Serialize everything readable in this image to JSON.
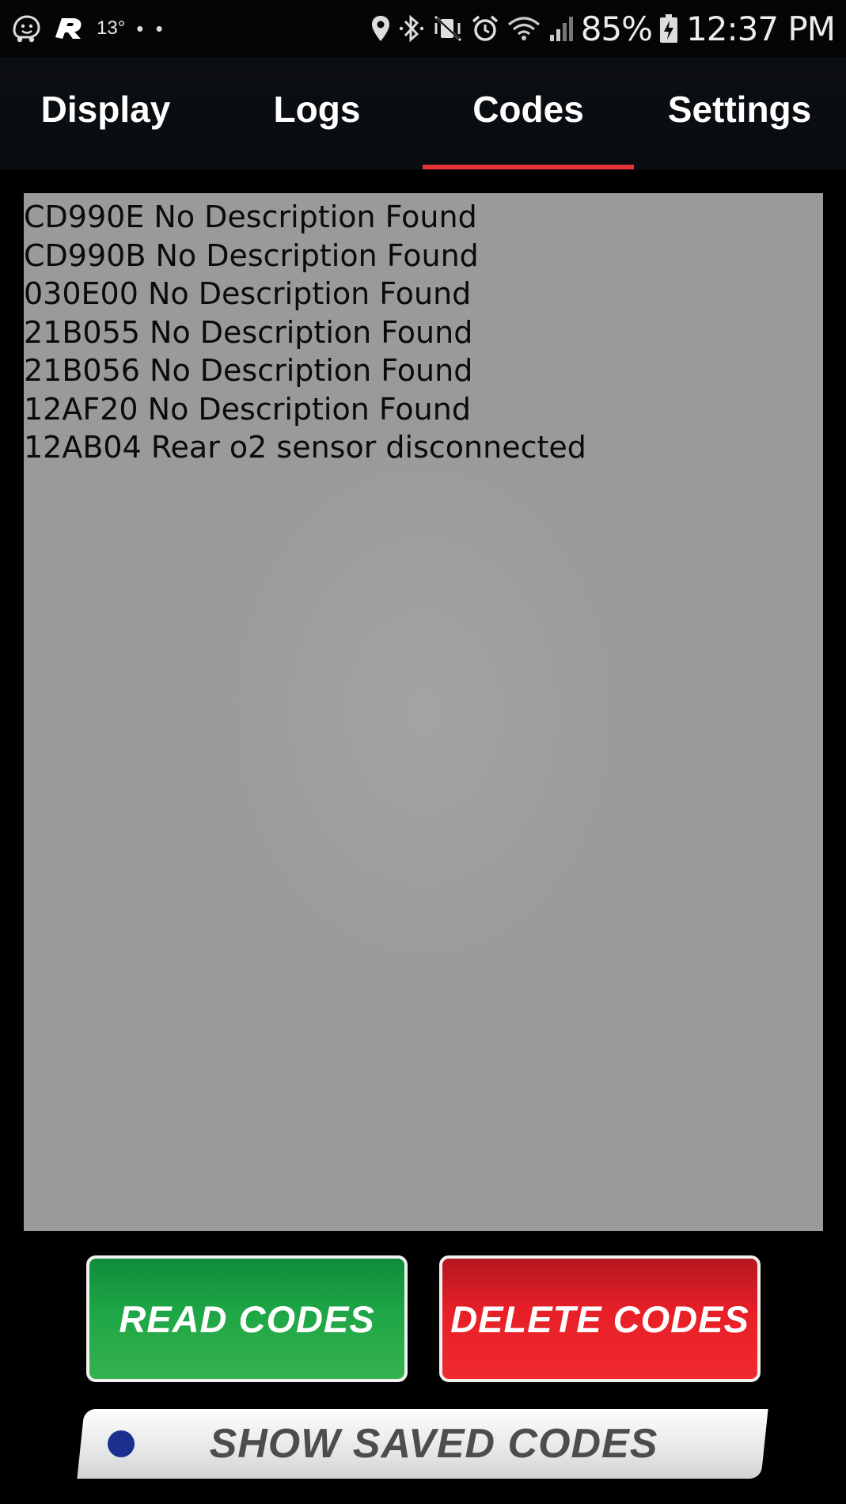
{
  "status_bar": {
    "temperature": "13°",
    "overflow": "• •",
    "battery_percent": "85%",
    "time": "12:37 PM",
    "icons": [
      "waze-icon",
      "app-r-icon",
      "location-icon",
      "bluetooth-icon",
      "vibrate-mute-icon",
      "alarm-icon",
      "wifi-icon",
      "signal-icon",
      "battery-charging-icon"
    ]
  },
  "tabs": [
    {
      "label": "Display",
      "active": false
    },
    {
      "label": "Logs",
      "active": false
    },
    {
      "label": "Codes",
      "active": true
    },
    {
      "label": "Settings",
      "active": false
    }
  ],
  "codes": [
    "CD990E No Description Found",
    "CD990B No Description Found",
    "030E00 No Description Found",
    "21B055 No Description Found",
    "21B056 No Description Found",
    "12AF20 No Description Found",
    "12AB04 Rear o2 sensor disconnected"
  ],
  "buttons": {
    "read": "READ CODES",
    "delete": "DELETE CODES",
    "show_saved": "SHOW SAVED CODES"
  },
  "colors": {
    "active_tab_indicator": "#e5333a",
    "read_button": "#1ea646",
    "delete_button": "#e81f27",
    "panel_background": "#9a9a9a"
  }
}
